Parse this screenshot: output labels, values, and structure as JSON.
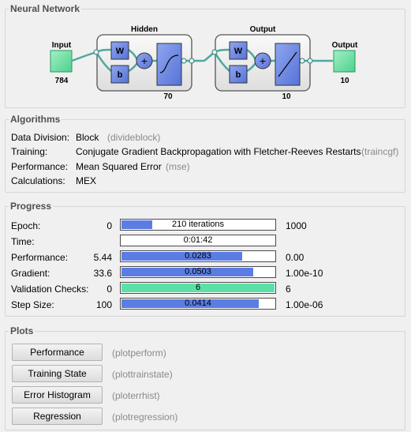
{
  "network": {
    "title": "Neural Network",
    "input_label": "Input",
    "input_size": "784",
    "hidden_label": "Hidden",
    "hidden_size": "70",
    "output_layer_label": "Output",
    "output_layer_size": "10",
    "output_label": "Output",
    "output_size": "10",
    "w_label": "W",
    "b_label": "b"
  },
  "algorithms": {
    "title": "Algorithms",
    "rows": [
      {
        "label": "Data Division:",
        "value": "Block",
        "code": "(divideblock)"
      },
      {
        "label": "Training:",
        "value": "Conjugate Gradient Backpropagation with Fletcher-Reeves Restarts",
        "code": "(traincgf)"
      },
      {
        "label": "Performance:",
        "value": "Mean Squared Error",
        "code": "(mse)"
      },
      {
        "label": "Calculations:",
        "value": "MEX",
        "code": ""
      }
    ]
  },
  "progress": {
    "title": "Progress",
    "rows": [
      {
        "label": "Epoch:",
        "start": "0",
        "bar_text": "210 iterations",
        "fraction": 0.21,
        "end": "1000"
      },
      {
        "label": "Time:",
        "start": "",
        "bar_text": "0:01:42",
        "fraction": 0,
        "end": ""
      },
      {
        "label": "Performance:",
        "start": "5.44",
        "bar_text": "0.0283",
        "fraction": 0.79,
        "end": "0.00"
      },
      {
        "label": "Gradient:",
        "start": "33.6",
        "bar_text": "0.0503",
        "fraction": 0.86,
        "end": "1.00e-10"
      },
      {
        "label": "Validation Checks:",
        "start": "0",
        "bar_text": "6",
        "fraction": 1.0,
        "end": "6"
      },
      {
        "label": "Step Size:",
        "start": "100",
        "bar_text": "0.0414",
        "fraction": 0.9,
        "end": "1.00e-06"
      }
    ]
  },
  "plots": {
    "title": "Plots",
    "buttons": [
      {
        "label": "Performance",
        "code": "(plotperform)"
      },
      {
        "label": "Training State",
        "code": "(plottrainstate)"
      },
      {
        "label": "Error Histogram",
        "code": "(ploterrhist)"
      },
      {
        "label": "Regression",
        "code": "(plotregression)"
      }
    ]
  },
  "colors": {
    "bar_fill": "#5b7de3",
    "bar_fill_validation": "#5ce0a8",
    "node_green": "#6fe3a5",
    "weight_blue": "#6b86e0"
  }
}
